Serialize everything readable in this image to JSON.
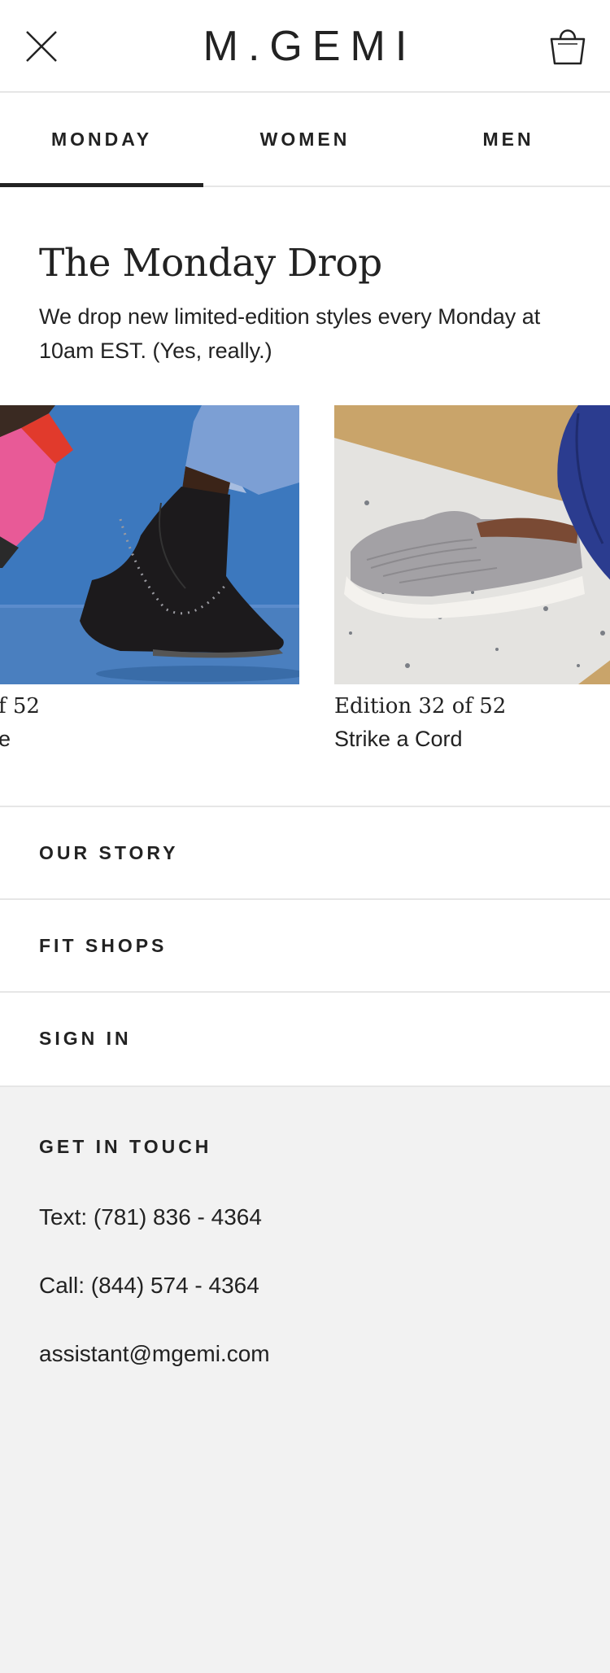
{
  "header": {
    "logo": "M.GEMI",
    "close_icon": "close-icon",
    "bag_icon": "shopping-bag-icon"
  },
  "tabs": [
    {
      "label": "MONDAY",
      "active": true
    },
    {
      "label": "WOMEN",
      "active": false
    },
    {
      "label": "MEN",
      "active": false
    }
  ],
  "monday_drop": {
    "title": "The Monday Drop",
    "description": "We drop new limited-edition styles every Monday at 10am EST. (Yes, really.)"
  },
  "carousel": {
    "cards": [
      {
        "edition": "f 52",
        "name": "e",
        "image": "black studded chelsea boot on blue background"
      },
      {
        "edition": "Edition 32 of 52",
        "name": "Strike a Cord",
        "image": "grey corded slip-on sneaker on terrazzo block"
      }
    ]
  },
  "menu": {
    "our_story": "OUR STORY",
    "fit_shops": "FIT SHOPS",
    "sign_in": "SIGN IN"
  },
  "footer": {
    "title": "GET IN TOUCH",
    "text": "Text: (781) 836 - 4364",
    "call": "Call: (844) 574 - 4364",
    "email": "assistant@mgemi.com"
  },
  "colors": {
    "text": "#222222",
    "divider": "#e6e6e6",
    "footer_bg": "#f2f2f2"
  }
}
